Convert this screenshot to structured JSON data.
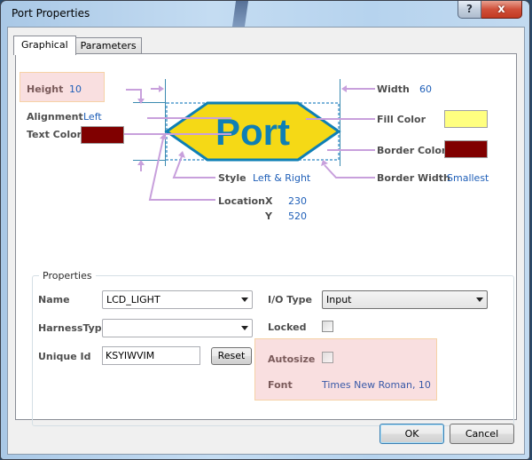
{
  "window": {
    "title": "Port Properties",
    "help_glyph": "?",
    "close_glyph": "x"
  },
  "tabs": [
    {
      "label": "Graphical",
      "active": true
    },
    {
      "label": "Parameters",
      "active": false
    }
  ],
  "graphical": {
    "height": {
      "label": "Height",
      "value": "10"
    },
    "alignment": {
      "label": "Alignment",
      "value": "Left"
    },
    "text_color": {
      "label": "Text Color",
      "color": "#800000"
    },
    "width": {
      "label": "Width",
      "value": "60"
    },
    "fill_color": {
      "label": "Fill Color",
      "color": "#ffff80"
    },
    "border_color": {
      "label": "Border Color",
      "color": "#800000"
    },
    "border_width": {
      "label": "Border Width",
      "value": "Smallest"
    },
    "style": {
      "label": "Style",
      "value": "Left & Right"
    },
    "location": {
      "label": "Location",
      "x_label": "X",
      "x_value": "230",
      "y_label": "Y",
      "y_value": "520"
    },
    "preview": {
      "text": "Port",
      "fill": "#f5d916",
      "stroke": "#0e7fb5",
      "text_color": "#0e7fb5",
      "callout_color": "#c8a0dc",
      "guide_color": "#3a8ab0"
    }
  },
  "properties": {
    "group_title": "Properties",
    "name": {
      "label": "Name",
      "value": "LCD_LIGHT"
    },
    "harness_type": {
      "label": "HarnessType",
      "value": ""
    },
    "unique_id": {
      "label": "Unique Id",
      "value": "KSYIWVIM",
      "reset_label": "Reset"
    },
    "io_type": {
      "label": "I/O Type",
      "value": "Input"
    },
    "locked": {
      "label": "Locked",
      "checked": false
    },
    "autosize": {
      "label": "Autosize",
      "checked": false
    },
    "font": {
      "label": "Font",
      "value": "Times New Roman, 10"
    }
  },
  "footer": {
    "ok_label": "OK",
    "cancel_label": "Cancel"
  }
}
